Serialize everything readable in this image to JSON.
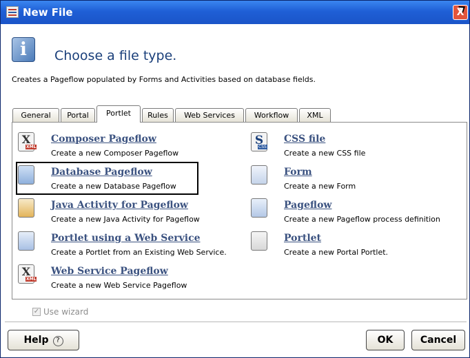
{
  "window": {
    "title": "New File",
    "close_label": "X"
  },
  "header": {
    "info_glyph": "i",
    "heading": "Choose a file type.",
    "description": "Creates a Pageflow populated by Forms and Activities based on database fields."
  },
  "tabs": [
    {
      "label": "General"
    },
    {
      "label": "Portal"
    },
    {
      "label": "Portlet",
      "active": true
    },
    {
      "label": "Rules"
    },
    {
      "label": "Web Services"
    },
    {
      "label": "Workflow"
    },
    {
      "label": "XML"
    }
  ],
  "file_types": {
    "left": [
      {
        "title": "Composer Pageflow",
        "desc": "Create a new Composer Pageflow",
        "icon": "xml-document-icon"
      },
      {
        "title": "Database Pageflow",
        "desc": "Create a new Database Pageflow",
        "icon": "database-icon",
        "selected": true
      },
      {
        "title": "Java Activity for Pageflow",
        "desc": "Create a new Java Activity for Pageflow",
        "icon": "java-activity-icon"
      },
      {
        "title": "Portlet using a Web Service",
        "desc": "Create a Portlet from an Existing Web Service.",
        "icon": "web-service-portlet-icon"
      },
      {
        "title": "Web Service Pageflow",
        "desc": "Create a new Web Service Pageflow",
        "icon": "xml-document-icon"
      }
    ],
    "right": [
      {
        "title": "CSS file",
        "desc": "Create a new CSS file",
        "icon": "css-file-icon",
        "glyph": "S"
      },
      {
        "title": "Form",
        "desc": "Create a new Form",
        "icon": "form-icon"
      },
      {
        "title": "Pageflow",
        "desc": "Create a new Pageflow process definition",
        "icon": "pageflow-icon"
      },
      {
        "title": "Portlet",
        "desc": "Create a new Portal Portlet.",
        "icon": "portlet-icon"
      }
    ],
    "xml_glyph": "X",
    "xml_tag": "XML",
    "css_tag": "CSS"
  },
  "wizard": {
    "label": "Use wizard",
    "checked": true,
    "enabled": false
  },
  "buttons": {
    "help": "Help",
    "help_glyph": "?",
    "ok": "OK",
    "cancel": "Cancel"
  }
}
